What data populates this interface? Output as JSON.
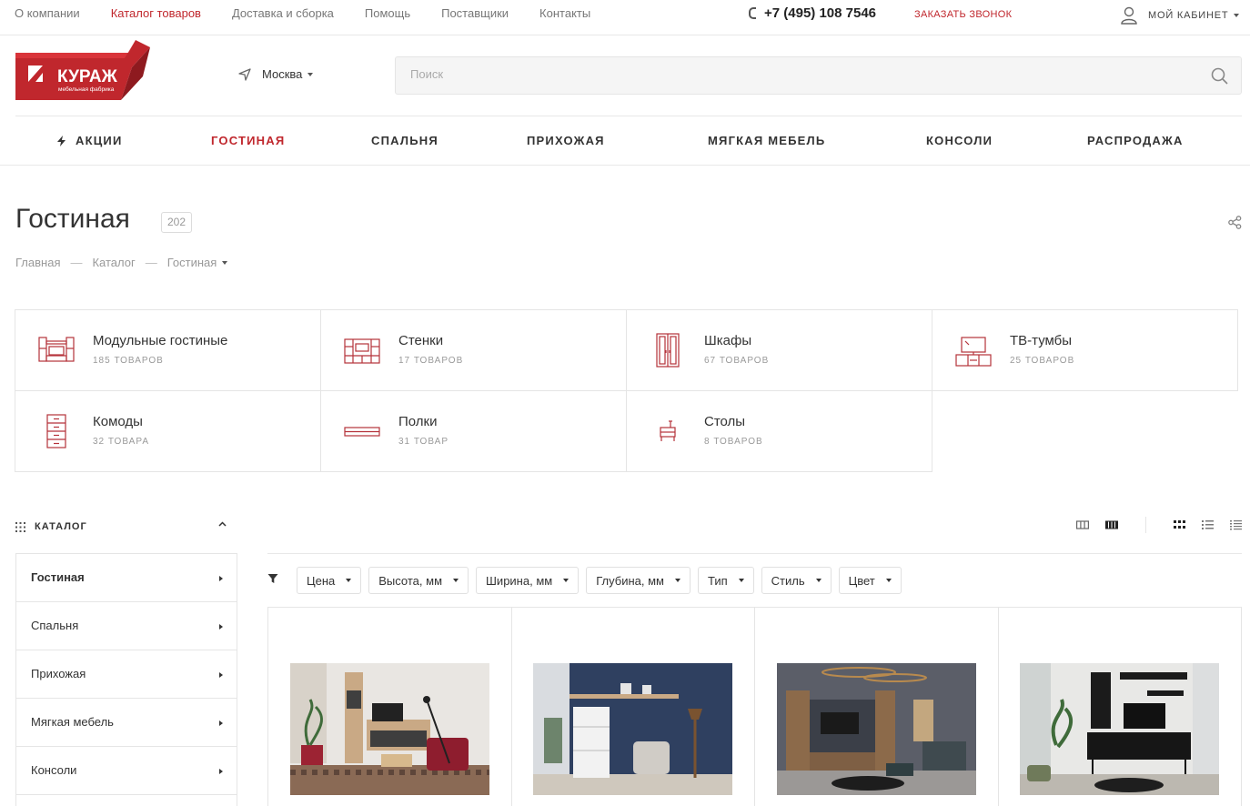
{
  "topnav": {
    "items": [
      "О компании",
      "Каталог товаров",
      "Доставка и сборка",
      "Помощь",
      "Поставщики",
      "Контакты"
    ],
    "active_index": 1
  },
  "phone": "+7 (495) 108 7546",
  "callback_label": "ЗАКАЗАТЬ ЗВОНОК",
  "cabinet_label": "МОЙ КАБИНЕТ",
  "logo": {
    "brand": "КУРАЖ",
    "tagline": "мебельная фабрика"
  },
  "city": "Москва",
  "search": {
    "placeholder": "Поиск"
  },
  "mainnav": {
    "items": [
      "АКЦИИ",
      "ГОСТИНАЯ",
      "СПАЛЬНЯ",
      "ПРИХОЖАЯ",
      "МЯГКАЯ МЕБЕЛЬ",
      "КОНСОЛИ",
      "РАСПРОДАЖА"
    ],
    "active_index": 1
  },
  "page": {
    "title": "Гостиная",
    "count": "202"
  },
  "breadcrumb": [
    "Главная",
    "Каталог",
    "Гостиная"
  ],
  "categories": [
    {
      "name": "Модульные гостиные",
      "count": "185 товаров",
      "icon": "modular-living-icon"
    },
    {
      "name": "Стенки",
      "count": "17 товаров",
      "icon": "wall-unit-icon"
    },
    {
      "name": "Шкафы",
      "count": "67 товаров",
      "icon": "wardrobe-icon"
    },
    {
      "name": "ТВ-тумбы",
      "count": "25 товаров",
      "icon": "tv-stand-icon"
    },
    {
      "name": "Комоды",
      "count": "32 товара",
      "icon": "dresser-icon"
    },
    {
      "name": "Полки",
      "count": "31 товар",
      "icon": "shelf-icon"
    },
    {
      "name": "Столы",
      "count": "8 товаров",
      "icon": "table-icon"
    }
  ],
  "catalog_label": "КАТАЛОГ",
  "sidebar": {
    "items": [
      "Гостиная",
      "Спальня",
      "Прихожая",
      "Мягкая мебель",
      "Консоли"
    ],
    "active_index": 0
  },
  "filters": [
    "Цена",
    "Высота, мм",
    "Ширина, мм",
    "Глубина, мм",
    "Тип",
    "Стиль",
    "Цвет"
  ],
  "colors": {
    "accent": "#c0272d",
    "text": "#333333",
    "muted": "#999999",
    "border": "#e5e5e5"
  }
}
